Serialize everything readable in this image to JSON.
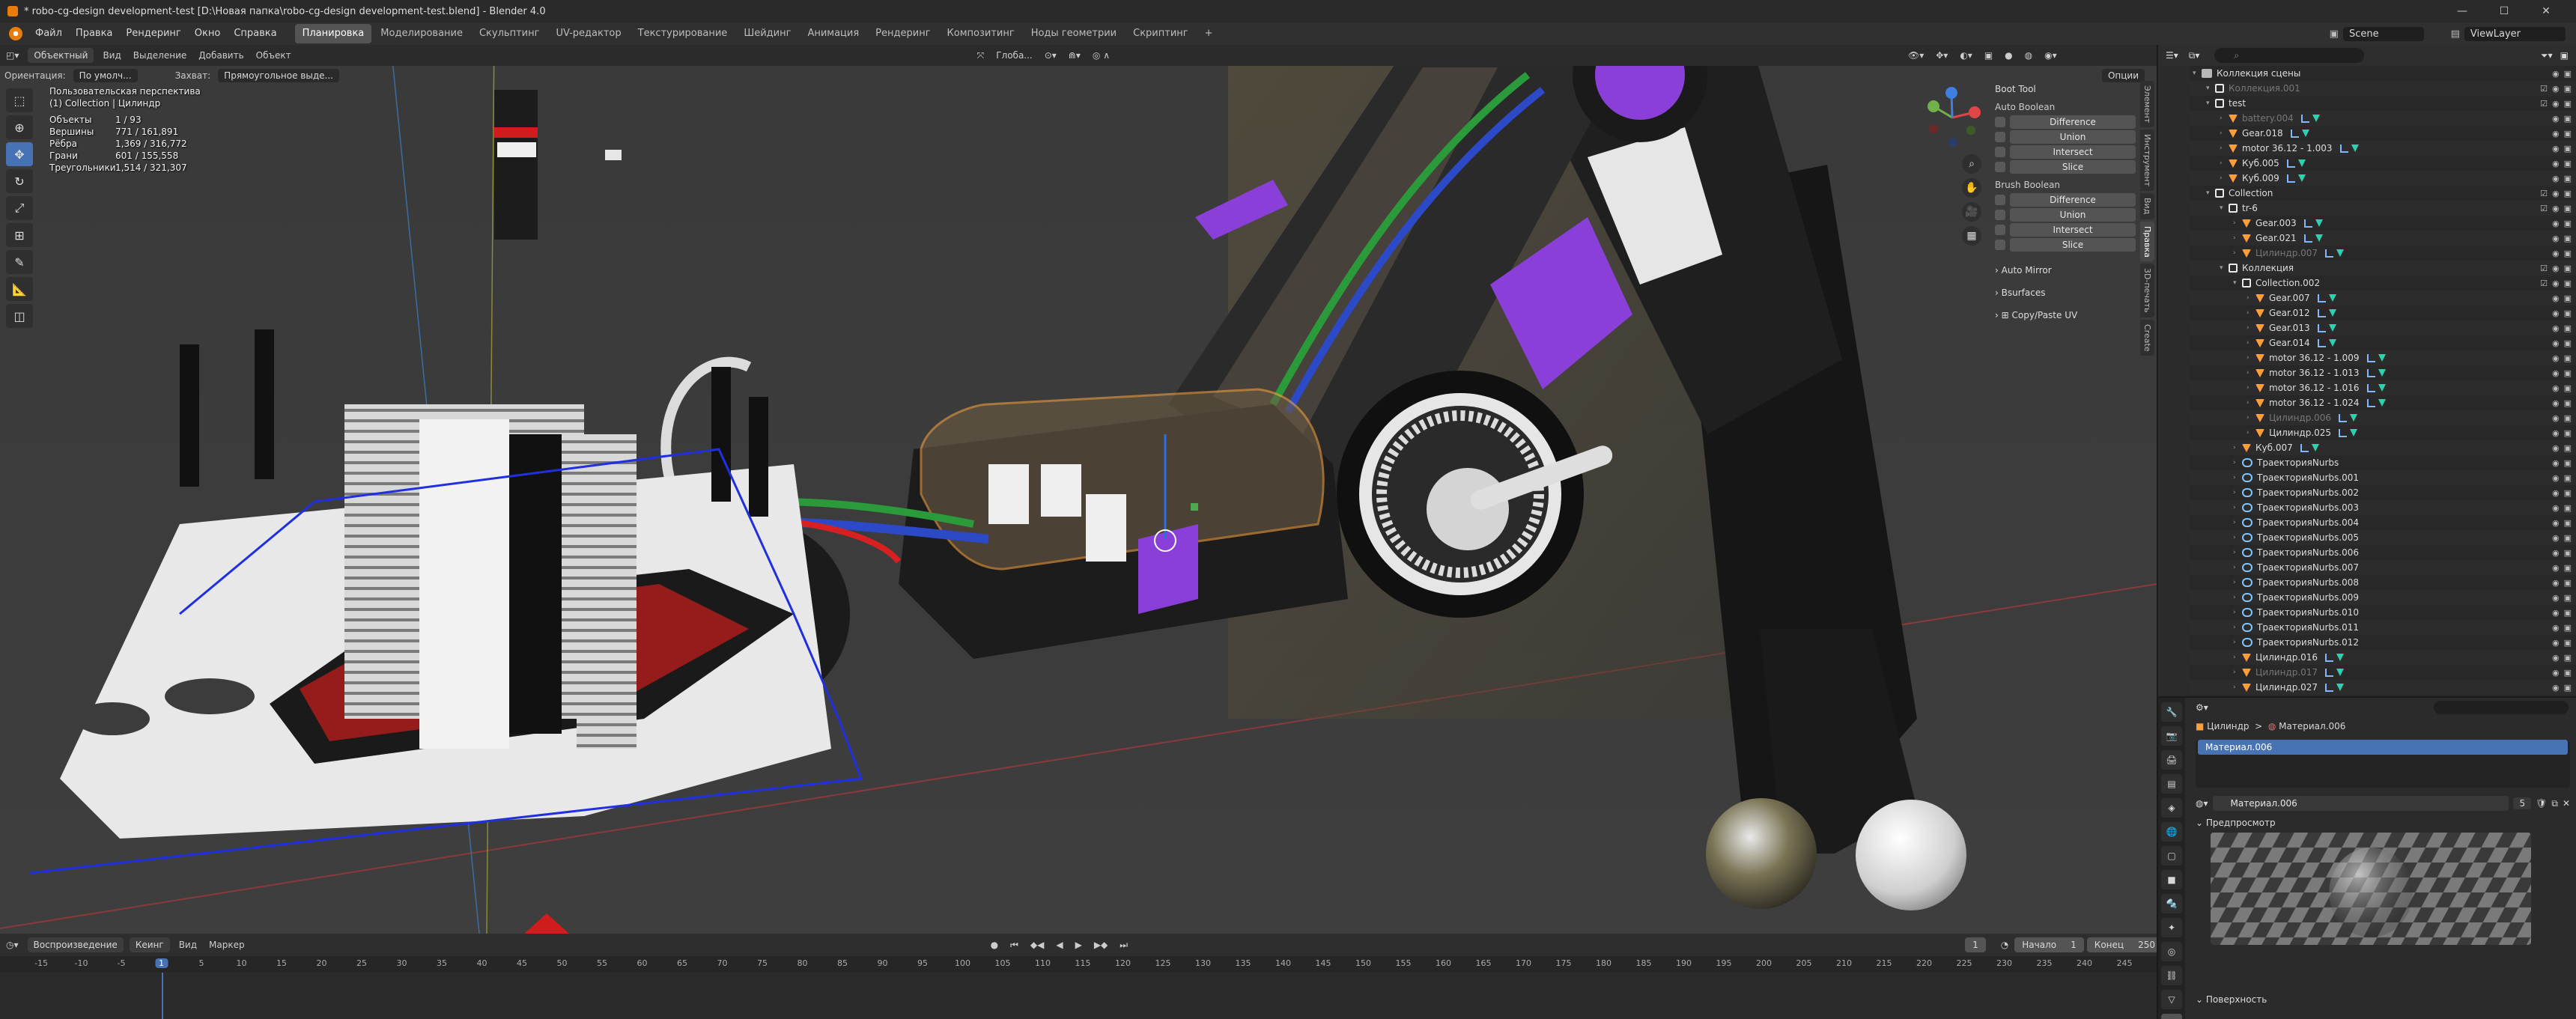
{
  "titlebar": {
    "title": "* robo-cg-design development-test [D:\\Новая папка\\robo-cg-design development-test.blend] - Blender 4.0",
    "minimize": "—",
    "maximize": "☐",
    "close": "✕"
  },
  "menus": [
    "Файл",
    "Правка",
    "Рендеринг",
    "Окно",
    "Справка"
  ],
  "workspaces": [
    "Планировка",
    "Моделирование",
    "Скульптинг",
    "UV-редактор",
    "Текстурирование",
    "Шейдинг",
    "Анимация",
    "Рендеринг",
    "Композитинг",
    "Ноды геометрии",
    "Скриптинг"
  ],
  "active_workspace": "Планировка",
  "workspace_add": "+",
  "scene": {
    "label": "Scene",
    "viewlayer": "ViewLayer"
  },
  "viewport_header": {
    "mode": "Объектный",
    "items": [
      "Вид",
      "Выделение",
      "Добавить",
      "Объект"
    ],
    "transform": "Глоба...",
    "options": "Опции"
  },
  "viewport_header2": {
    "orientation_label": "Ориентация:",
    "orientation_value": "По умолч...",
    "drag_label": "Захват:",
    "drag_value": "Прямоугольное выде..."
  },
  "overlay_info": {
    "view": "Пользовательская перспектива",
    "object": "(1) Collection | Цилиндр",
    "stats": [
      {
        "k": "Объекты",
        "v": "1 / 93"
      },
      {
        "k": "Вершины",
        "v": "771 / 161,891"
      },
      {
        "k": "Рёбра",
        "v": "1,369 / 316,772"
      },
      {
        "k": "Грани",
        "v": "601 / 155,558"
      },
      {
        "k": "Треугольники",
        "v": "1,514 / 321,307"
      }
    ]
  },
  "tools": [
    "select",
    "cursor",
    "move",
    "rotate",
    "scale",
    "transform",
    "annotate",
    "measure",
    "add-cube"
  ],
  "npanel": {
    "title": "Boot Tool",
    "auto_boolean": "Auto Boolean",
    "brush_boolean": "Brush Boolean",
    "buttons": [
      "Difference",
      "Union",
      "Intersect",
      "Slice"
    ],
    "auto_mirror": "Auto Mirror",
    "bsurfaces": "Bsurfaces",
    "copy_uv": "Copy/Paste UV",
    "tabs": [
      "Элемент",
      "Инструмент",
      "Вид",
      "Правка",
      "3D-печать",
      "Create"
    ]
  },
  "timeline": {
    "playback": "Воспроизведение",
    "keying": "Кеинг",
    "view": "Вид",
    "marker": "Маркер",
    "current_frame": "1",
    "start_label": "Начало",
    "start": "1",
    "end_label": "Конец",
    "end": "250",
    "ticks": [
      "-15",
      "-10",
      "-5",
      "1",
      "5",
      "10",
      "15",
      "20",
      "25",
      "30",
      "35",
      "40",
      "45",
      "50",
      "55",
      "60",
      "65",
      "70",
      "75",
      "80",
      "85",
      "90",
      "95",
      "100",
      "105",
      "110",
      "115",
      "120",
      "125",
      "130",
      "135",
      "140",
      "145",
      "150",
      "155",
      "160",
      "165",
      "170",
      "175",
      "180",
      "185",
      "190",
      "195",
      "200",
      "205",
      "210",
      "215",
      "220",
      "225",
      "230",
      "235",
      "240",
      "245"
    ]
  },
  "outliner": {
    "search_placeholder": "",
    "rows": [
      {
        "d": 0,
        "name": "Коллекция сцены",
        "type": "scene",
        "dim": false
      },
      {
        "d": 1,
        "name": "Коллекция.001",
        "type": "coll",
        "dim": true
      },
      {
        "d": 1,
        "name": "test",
        "type": "coll",
        "dim": false
      },
      {
        "d": 2,
        "name": "battery.004",
        "type": "obj",
        "dim": true
      },
      {
        "d": 2,
        "name": "Gear.018",
        "type": "obj",
        "dim": false
      },
      {
        "d": 2,
        "name": "motor 36.12 - 1.003",
        "type": "obj",
        "dim": false
      },
      {
        "d": 2,
        "name": "Куб.005",
        "type": "obj",
        "dim": false
      },
      {
        "d": 2,
        "name": "Куб.009",
        "type": "obj",
        "dim": false
      },
      {
        "d": 1,
        "name": "Collection",
        "type": "coll",
        "dim": false
      },
      {
        "d": 2,
        "name": "tr-6",
        "type": "coll",
        "dim": false
      },
      {
        "d": 3,
        "name": "Gear.003",
        "type": "obj",
        "dim": false
      },
      {
        "d": 3,
        "name": "Gear.021",
        "type": "obj",
        "dim": false
      },
      {
        "d": 3,
        "name": "Цилиндр.007",
        "type": "obj",
        "dim": true
      },
      {
        "d": 2,
        "name": "Коллекция",
        "type": "coll",
        "dim": false
      },
      {
        "d": 3,
        "name": "Collection.002",
        "type": "coll",
        "dim": false
      },
      {
        "d": 4,
        "name": "Gear.007",
        "type": "obj",
        "dim": false
      },
      {
        "d": 4,
        "name": "Gear.012",
        "type": "obj",
        "dim": false
      },
      {
        "d": 4,
        "name": "Gear.013",
        "type": "obj",
        "dim": false
      },
      {
        "d": 4,
        "name": "Gear.014",
        "type": "obj",
        "dim": false
      },
      {
        "d": 4,
        "name": "motor 36.12 - 1.009",
        "type": "obj",
        "dim": false
      },
      {
        "d": 4,
        "name": "motor 36.12 - 1.013",
        "type": "obj",
        "dim": false
      },
      {
        "d": 4,
        "name": "motor 36.12 - 1.016",
        "type": "obj",
        "dim": false
      },
      {
        "d": 4,
        "name": "motor 36.12 - 1.024",
        "type": "obj",
        "dim": false
      },
      {
        "d": 4,
        "name": "Цилиндр.006",
        "type": "obj",
        "dim": true
      },
      {
        "d": 4,
        "name": "Цилиндр.025",
        "type": "obj",
        "dim": false
      },
      {
        "d": 3,
        "name": "Куб.007",
        "type": "obj",
        "dim": false
      },
      {
        "d": 3,
        "name": "ТраекторияNurbs",
        "type": "curve",
        "dim": false
      },
      {
        "d": 3,
        "name": "ТраекторияNurbs.001",
        "type": "curve",
        "dim": false
      },
      {
        "d": 3,
        "name": "ТраекторияNurbs.002",
        "type": "curve",
        "dim": false
      },
      {
        "d": 3,
        "name": "ТраекторияNurbs.003",
        "type": "curve",
        "dim": false
      },
      {
        "d": 3,
        "name": "ТраекторияNurbs.004",
        "type": "curve",
        "dim": false
      },
      {
        "d": 3,
        "name": "ТраекторияNurbs.005",
        "type": "curve",
        "dim": false
      },
      {
        "d": 3,
        "name": "ТраекторияNurbs.006",
        "type": "curve",
        "dim": false
      },
      {
        "d": 3,
        "name": "ТраекторияNurbs.007",
        "type": "curve",
        "dim": false
      },
      {
        "d": 3,
        "name": "ТраекторияNurbs.008",
        "type": "curve",
        "dim": false
      },
      {
        "d": 3,
        "name": "ТраекторияNurbs.009",
        "type": "curve",
        "dim": false
      },
      {
        "d": 3,
        "name": "ТраекторияNurbs.010",
        "type": "curve",
        "dim": false
      },
      {
        "d": 3,
        "name": "ТраекторияNurbs.011",
        "type": "curve",
        "dim": false
      },
      {
        "d": 3,
        "name": "ТраекторияNurbs.012",
        "type": "curve",
        "dim": false
      },
      {
        "d": 3,
        "name": "Цилиндр.016",
        "type": "obj",
        "dim": false
      },
      {
        "d": 3,
        "name": "Цилиндр.017",
        "type": "obj",
        "dim": true
      },
      {
        "d": 3,
        "name": "Цилиндр.027",
        "type": "obj",
        "dim": false
      }
    ]
  },
  "properties": {
    "breadcrumb_object": "Цилиндр",
    "breadcrumb_sep": ">",
    "breadcrumb_material": "Материал.006",
    "slot": "Материал.006",
    "material_field": "Материал.006",
    "users": "5",
    "preview_section": "Предпросмотр",
    "surface_section": "Поверхность"
  }
}
